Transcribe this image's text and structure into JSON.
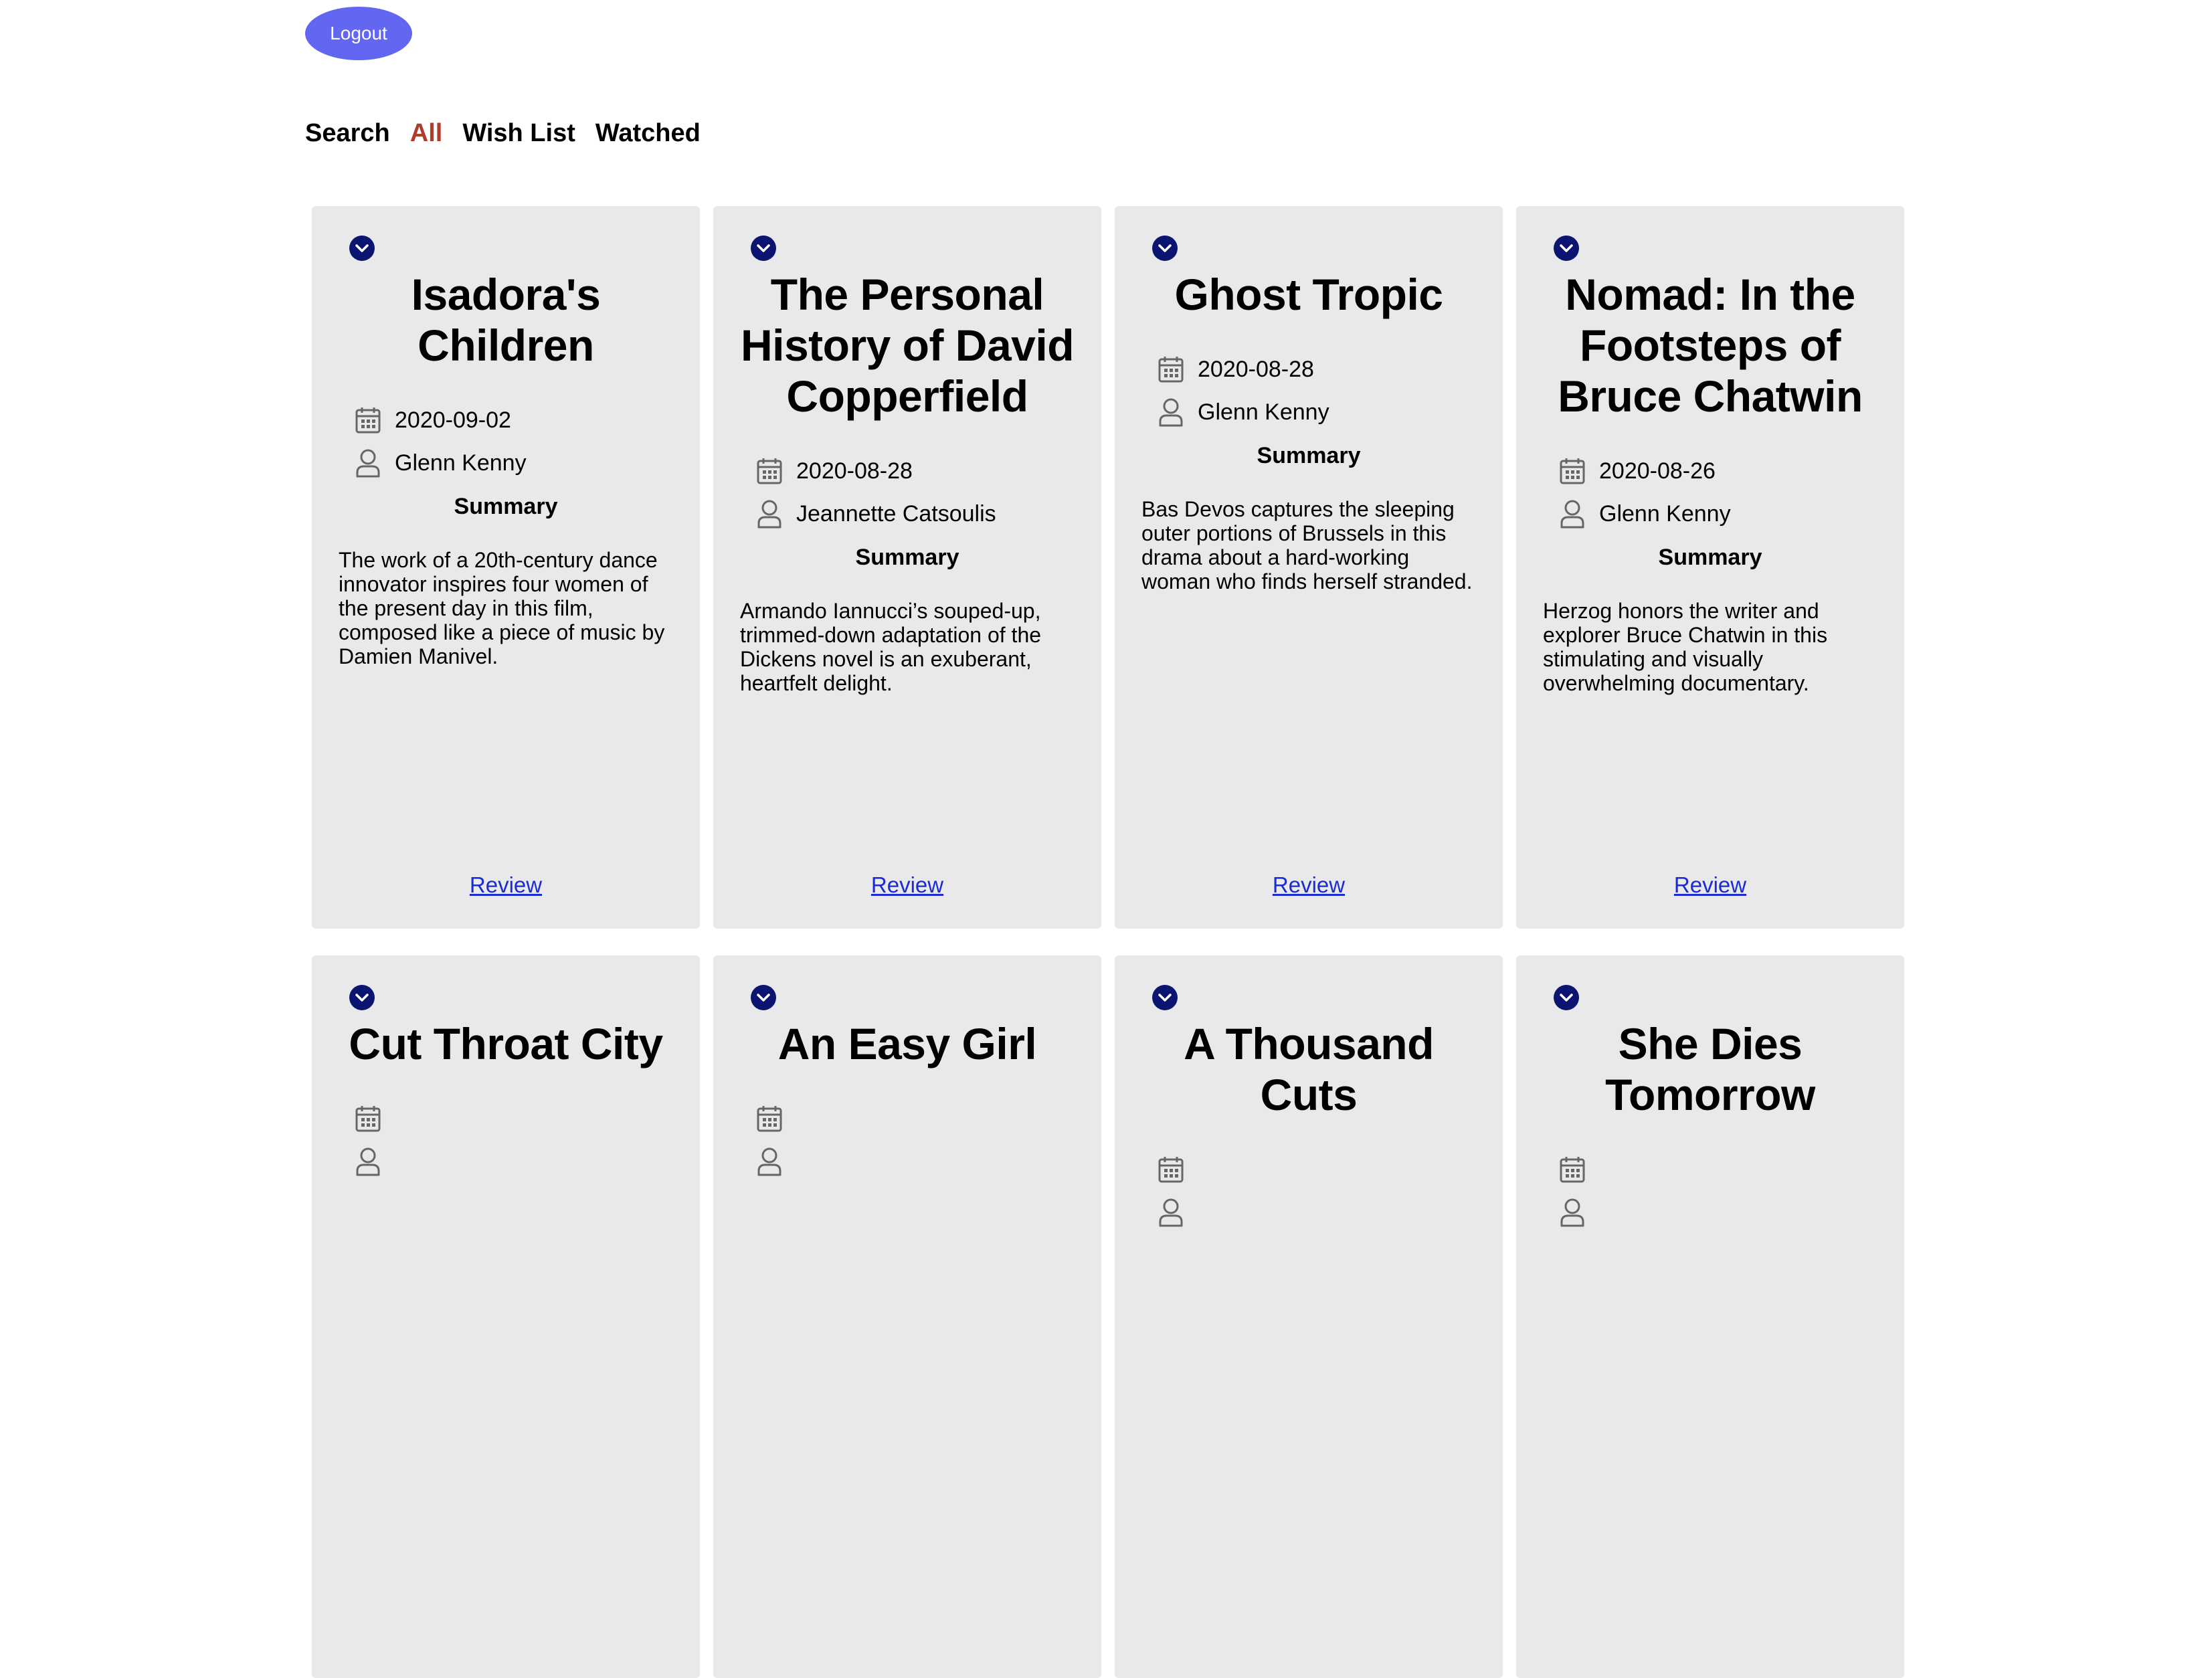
{
  "header": {
    "logout_label": "Logout"
  },
  "nav": {
    "items": [
      {
        "label": "Search",
        "active": false
      },
      {
        "label": "All",
        "active": true
      },
      {
        "label": "Wish List",
        "active": false
      },
      {
        "label": "Watched",
        "active": false
      }
    ],
    "active_color": "#b23a28"
  },
  "colors": {
    "logout_button": "#6366f1",
    "card_background": "#e9e9eb",
    "toggle_icon": "#0b1570",
    "link": "#1a2bd6"
  },
  "icons": {
    "toggle": "chevron-down-icon",
    "date": "calendar-icon",
    "critic": "user-icon"
  },
  "cards": [
    {
      "title": "Isadora's Children",
      "date": "2020-09-02",
      "critic": "Glenn Kenny",
      "summary_heading": "Summary",
      "summary": "The work of a 20th-century dance innovator inspires four women of the present day in this film, composed like a piece of music by Damien Manivel.",
      "review_label": "Review"
    },
    {
      "title": "The Personal History of David Copperfield",
      "date": "2020-08-28",
      "critic": "Jeannette Catsoulis",
      "summary_heading": "Summary",
      "summary": "Armando Iannucci’s souped-up, trimmed-down adaptation of the Dickens novel is an exuberant, heartfelt delight.",
      "review_label": "Review"
    },
    {
      "title": "Ghost Tropic",
      "date": "2020-08-28",
      "critic": "Glenn Kenny",
      "summary_heading": "Summary",
      "summary": "Bas Devos captures the sleeping outer portions of Brussels in this drama about a hard-working woman who finds herself stranded.",
      "review_label": "Review"
    },
    {
      "title": "Nomad: In the Footsteps of Bruce Chatwin",
      "date": "2020-08-26",
      "critic": "Glenn Kenny",
      "summary_heading": "Summary",
      "summary": "Herzog honors the writer and explorer Bruce Chatwin in this stimulating and visually overwhelming documentary.",
      "review_label": "Review"
    },
    {
      "title": "Cut Throat City"
    },
    {
      "title": "An Easy Girl"
    },
    {
      "title": "A Thousand Cuts"
    },
    {
      "title": "She Dies Tomorrow"
    }
  ]
}
